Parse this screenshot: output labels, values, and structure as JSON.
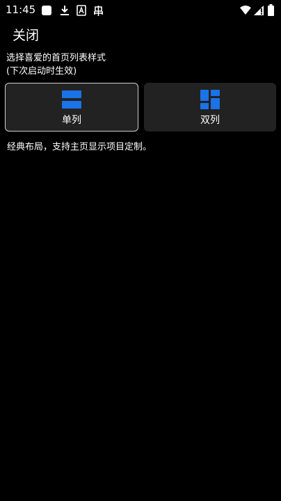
{
  "status_bar": {
    "time": "11:45",
    "icons": [
      "notification-square-icon",
      "download-icon",
      "app-a-icon",
      "bug-icon",
      "wifi-icon",
      "signal-icon",
      "battery-icon"
    ]
  },
  "header": {
    "close_label": "关闭"
  },
  "prompt": {
    "line1": "选择喜爱的首页列表样式",
    "line2": "(下次启动时生效)"
  },
  "options": [
    {
      "label": "单列",
      "icon": "single-column-layout-icon",
      "selected": true
    },
    {
      "label": "双列",
      "icon": "double-column-layout-icon",
      "selected": false
    }
  ],
  "description": "经典布局，支持主页显示项目定制。",
  "colors": {
    "background": "#000000",
    "card": "#222222",
    "selected_border": "#d0d0d0",
    "accent": "#1a73e8",
    "text": "#ffffff"
  }
}
